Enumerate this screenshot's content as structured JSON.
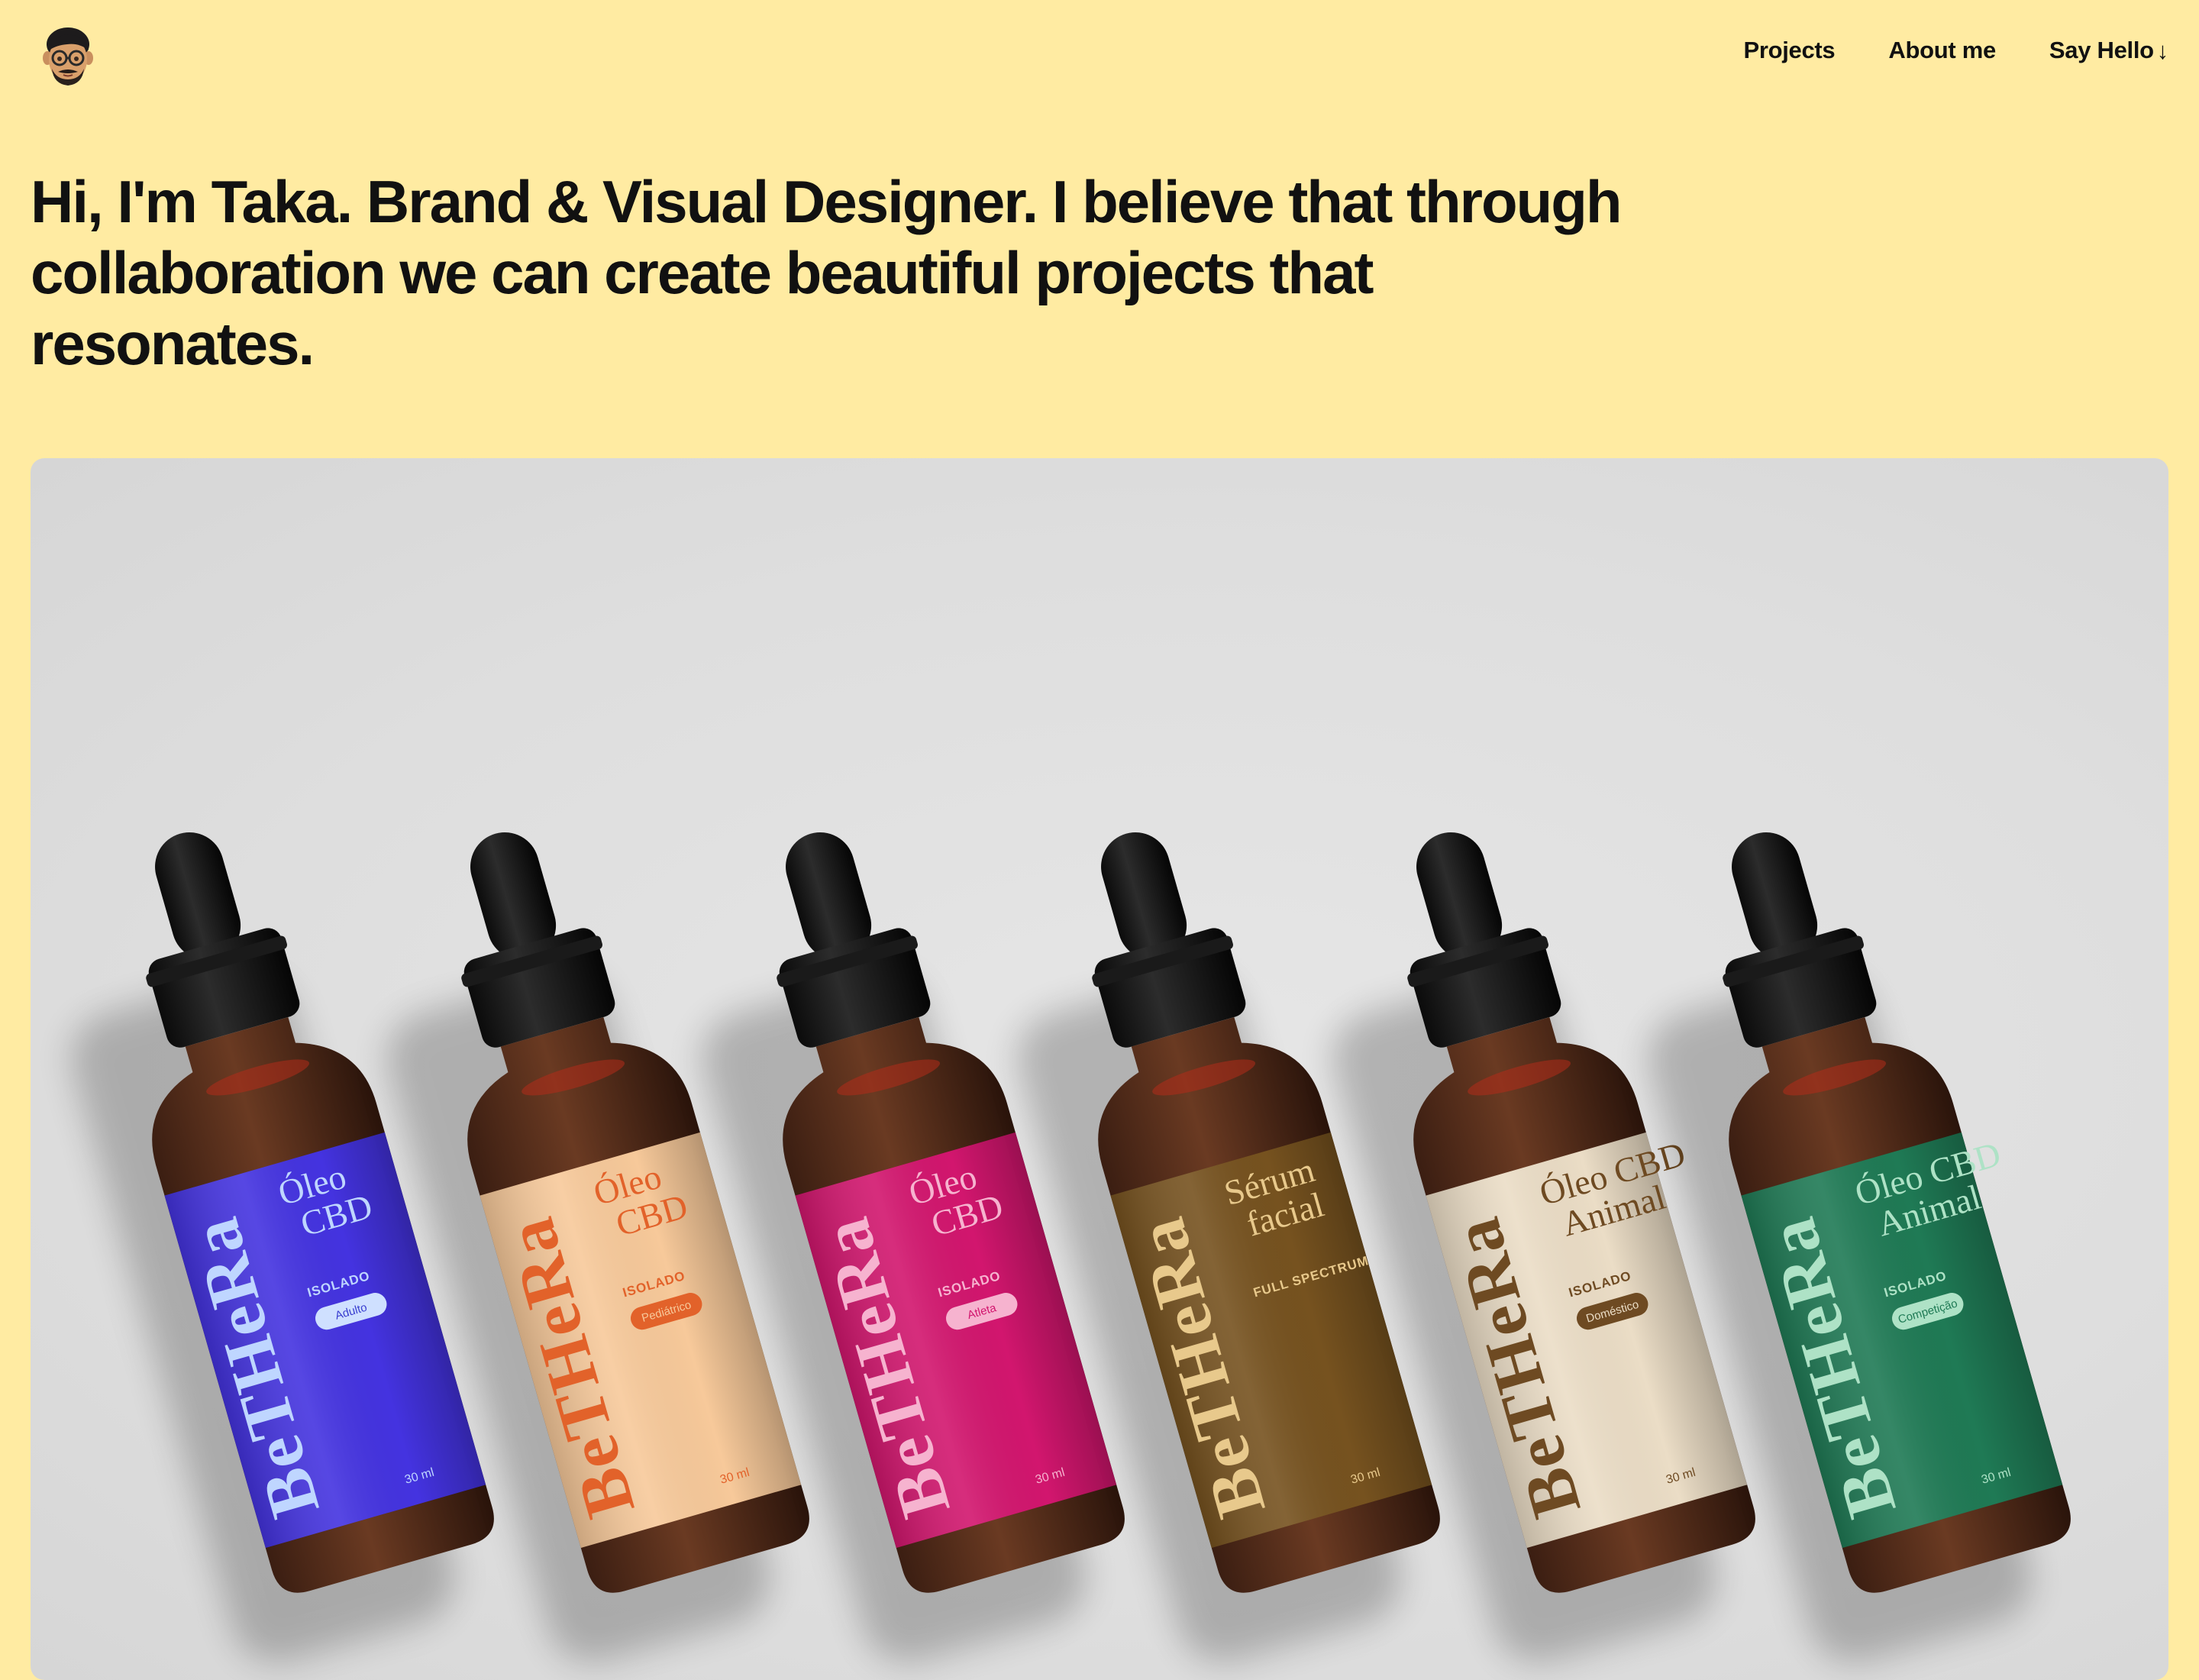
{
  "nav": {
    "projects": "Projects",
    "about": "About me",
    "hello": "Say Hello",
    "hello_arrow": "↓"
  },
  "hero": {
    "text": "Hi, I'm Taka. Brand & Visual Designer. I believe that through collaboration we can create beautiful projects that resonates."
  },
  "project": {
    "brand": "BeTHeRa",
    "bottles": [
      {
        "title1": "Óleo",
        "title2": "CBD",
        "subtitle": "ISOLADO",
        "pill": "Adulto",
        "volume": "30 ml",
        "color": "#4433E0",
        "text_color": "#BFD6FF",
        "pill_bg": "#CFE0FF",
        "pill_text": "#3A3FD0"
      },
      {
        "title1": "Óleo",
        "title2": "CBD",
        "subtitle": "ISOLADO",
        "pill": "Pediátrico",
        "volume": "30 ml",
        "color": "#F7C99A",
        "text_color": "#E2622A",
        "pill_bg": "#E2622A",
        "pill_text": "#F7C99A"
      },
      {
        "title1": "Óleo",
        "title2": "CBD",
        "subtitle": "ISOLADO",
        "pill": "Atleta",
        "volume": "30 ml",
        "color": "#D2166E",
        "text_color": "#F6B3CF",
        "pill_bg": "#F6B3CF",
        "pill_text": "#D2166E"
      },
      {
        "title1": "Sérum",
        "title2": "facial",
        "subtitle": "FULL SPECTRUM",
        "pill": "",
        "volume": "30 ml",
        "color": "#76521F",
        "text_color": "#E8C98C",
        "pill_bg": "#E8C98C",
        "pill_text": "#76521F"
      },
      {
        "title1": "Óleo CBD",
        "title2": "Animal",
        "subtitle": "ISOLADO",
        "pill": "Doméstico",
        "volume": "30 ml",
        "color": "#EBDDC6",
        "text_color": "#6E4A22",
        "pill_bg": "#6E4A22",
        "pill_text": "#EBDDC6"
      },
      {
        "title1": "Óleo CBD",
        "title2": "Animal",
        "subtitle": "ISOLADO",
        "pill": "Competição",
        "volume": "30 ml",
        "color": "#1F7A55",
        "text_color": "#AEE2C6",
        "pill_bg": "#AEE2C6",
        "pill_text": "#1F7A55"
      }
    ]
  }
}
